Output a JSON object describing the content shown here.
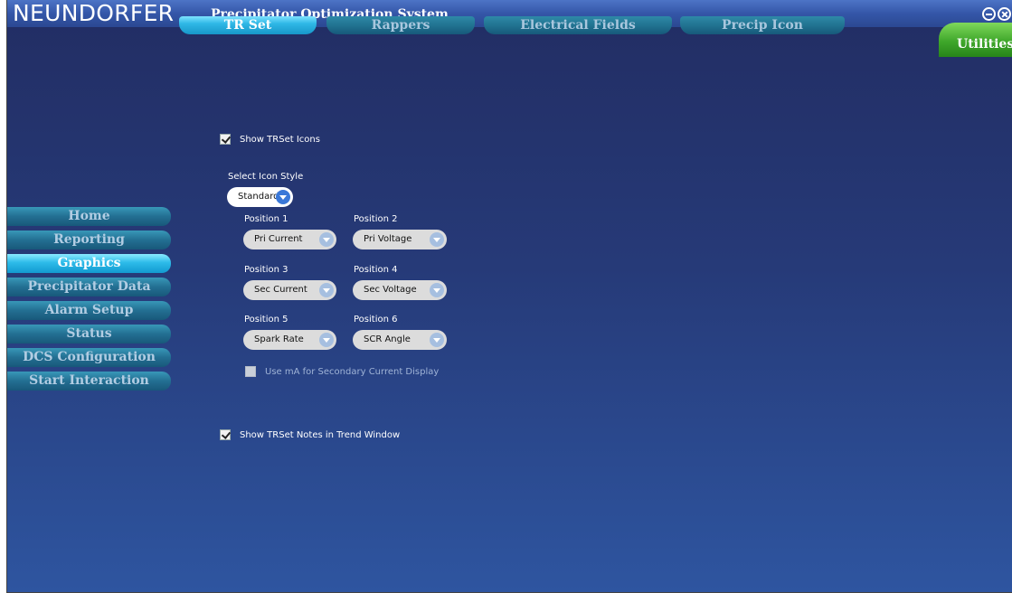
{
  "titlebar": {
    "brand": "NEUNDORFER",
    "subtitle": "Precipitator Optimization System"
  },
  "tabs": [
    {
      "label": "TR Set",
      "active": true
    },
    {
      "label": "Rappers",
      "active": false
    },
    {
      "label": "Electrical Fields",
      "active": false
    },
    {
      "label": "Precip Icon",
      "active": false
    },
    {
      "label": "Utilities",
      "active": false
    }
  ],
  "sidebar": {
    "items": [
      {
        "label": "Home",
        "active": false
      },
      {
        "label": "Reporting",
        "active": false
      },
      {
        "label": "Graphics",
        "active": true
      },
      {
        "label": "Precipitator Data",
        "active": false
      },
      {
        "label": "Alarm Setup",
        "active": false
      },
      {
        "label": "Status",
        "active": false
      },
      {
        "label": "DCS Configuration",
        "active": false
      },
      {
        "label": "Start Interaction",
        "active": false
      }
    ]
  },
  "settings": {
    "show_icons": {
      "label": "Show TRSet Icons",
      "checked": true
    },
    "icon_style": {
      "label": "Select Icon Style",
      "value": "Standard"
    },
    "positions": [
      {
        "label": "Position 1",
        "value": "Pri Current"
      },
      {
        "label": "Position 2",
        "value": "Pri Voltage"
      },
      {
        "label": "Position 3",
        "value": "Sec Current"
      },
      {
        "label": "Position 4",
        "value": "Sec Voltage"
      },
      {
        "label": "Position 5",
        "value": "Spark Rate"
      },
      {
        "label": "Position 6",
        "value": "SCR Angle"
      }
    ],
    "use_ma": {
      "label": "Use mA for Secondary Current Display",
      "checked": false,
      "enabled": false
    },
    "show_notes": {
      "label": "Show TRSet Notes in Trend Window",
      "checked": true
    }
  },
  "icons": {
    "minimize": "minimize-icon",
    "close": "close-icon",
    "dropdown": "chevron-down-icon"
  },
  "colors": {
    "background_top": "#222d63",
    "background_bottom": "#2e55a0",
    "active_tab": "#2fb8e6",
    "utilities_tab": "#3fa72b"
  }
}
